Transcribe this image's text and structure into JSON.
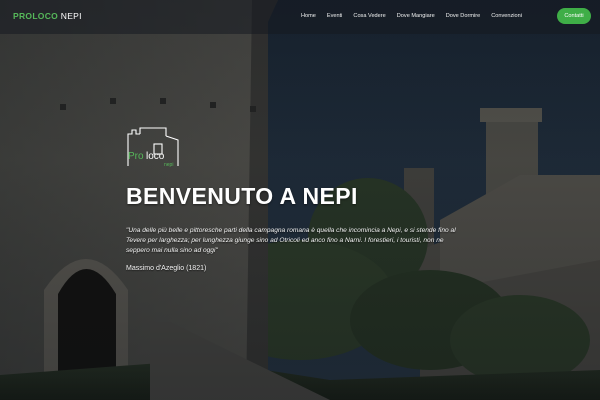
{
  "navbar": {
    "brand_part1": "PROLOCO",
    "brand_part2": "NEPI",
    "links": [
      "Home",
      "Eventi",
      "Cosa Vedere",
      "Dove Mangiare",
      "Dove Dormire",
      "Convenzioni"
    ],
    "contact_label": "Contatti"
  },
  "logo": {
    "text_pro": "Pro",
    "text_loco": "loco",
    "text_nepi": "nepi"
  },
  "hero": {
    "title": "BENVENUTO A NEPI",
    "quote": "\"Una delle più belle e pittoresche parti della campagna romana è quella che incomincia a Nepi, e si stende fino al Tevere per larghezza; per lunghezza giunge sino ad Otricoli ed anco fino a Narni. I forestieri, i touristi, non ne seppero mai nulla sino ad oggi\"",
    "author": "Massimo d'Azeglio (1821)"
  },
  "colors": {
    "accent_green": "#3fae47",
    "brand_green": "#56b85a",
    "sky": "#27374a"
  },
  "icons": [
    "castle-logo-icon"
  ]
}
